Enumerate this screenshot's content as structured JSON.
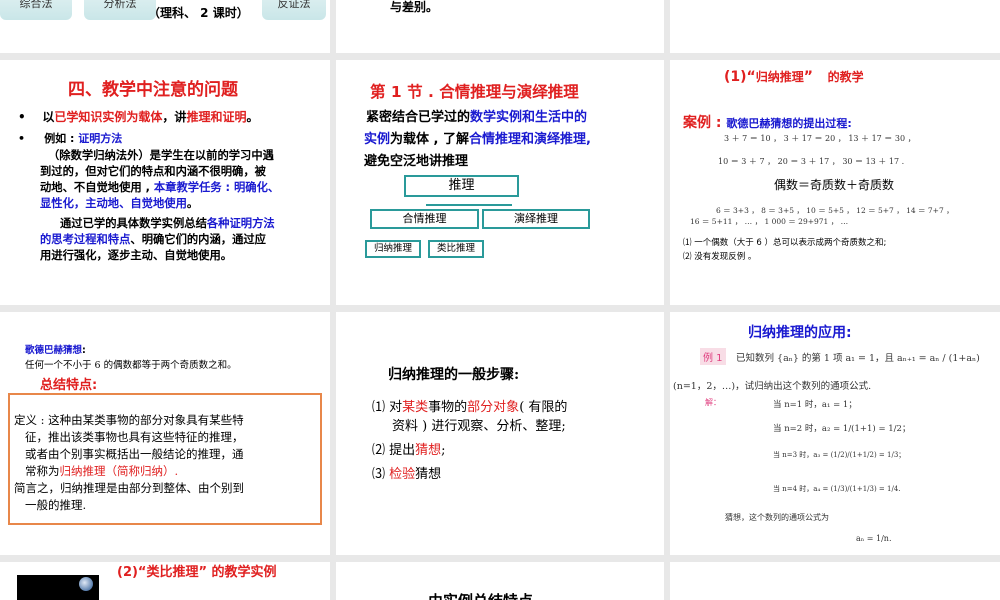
{
  "slide_top_left": {
    "buttons": [
      "综合法",
      "分析法",
      "反证法"
    ],
    "note": "（理科、 2 课时）"
  },
  "slide_top_mid": {
    "text": "与差别。"
  },
  "slide4": {
    "title": "四、教学中注意的问题",
    "b1": [
      "以",
      "已学知识实例为载体",
      "，讲",
      "推理和证明",
      "。"
    ],
    "b2": [
      "例如 : ",
      "证明方法"
    ],
    "p1": [
      "（除数学归纳法外）是学生在以前的学习中遇",
      "到过的，但对它们的特点和内涵不很明确，被",
      "动地、不自觉地使用 , ",
      "本章教学任务 : 明确化、",
      "显性化，主动地、自觉地使用",
      "。"
    ],
    "p2": [
      "通过已学的具体数学实例总结",
      "各种证明方法",
      "的思考过程和特点",
      "、明确它们的内涵，通过应",
      "用进行强化，逐步主动、自觉地使用。"
    ]
  },
  "slide5": {
    "title": "第 1 节 . 合情推理与演绎推理",
    "l1": [
      "紧密结合已学过的",
      "数学实例和生活中的"
    ],
    "l2": [
      "实例",
      "为载体 , 了解",
      "合情推理和演绎推理,"
    ],
    "l3": "避免空泛地讲推理",
    "diagram": {
      "root": "推理",
      "a": "合情推理",
      "b": "演绎推理",
      "a1": "归纳推理",
      "a2": "类比推理"
    }
  },
  "slide6": {
    "title_a": "(1)“",
    "title_b": "归纳推理",
    "title_c": "”",
    "title_d": "的教学",
    "case_label": "案例 : ",
    "case_text": "歌德巴赫猜想的提出过程:",
    "eq1": "3 ＋ 7 ＝ 10 ， 3 ＋ 17 ＝ 20 ， 13 ＋ 17 ＝ 30 ，",
    "eq2": "10 ＝ 3 ＋ 7 ， 20 ＝ 3 ＋ 17 ， 30 ＝ 13 ＋ 17 .",
    "rule": "偶数＝奇质数＋奇质数",
    "eq3": "6 ＝ 3+3 ， 8 ＝ 3+5 ， 10 ＝ 5+5 ， 12 ＝ 5+7 ， 14 ＝ 7+7 ，",
    "eq4": "16 ＝ 5+11 ，  … ，              1 000 ＝ 29+971 ，  …",
    "c1": "⑴  一个偶数（大于 6 ）总可以表示成两个奇质数之和;",
    "c2": "⑵  没有发现反例 。"
  },
  "slide7": {
    "conj_label": "歌德巴赫猜想",
    "conj_colon": ":",
    "conj": "任何一个不小于 6 的偶数都等于两个奇质数之和。",
    "summary": "总结特点:",
    "d1": "定义 : 这种由某类事物的部分对象具有某些特",
    "d2": "征，推出该类事物也具有这些特征的推理，",
    "d3": "或者由个别事实概括出一般结论的推理，通",
    "d4a": "常称为",
    "d4b": "归纳推理（简称归纳）.",
    "d5": "简言之，归纳推理是由部分到整体、由个别到",
    "d6": "一般的推理."
  },
  "slide8": {
    "title": "归纳推理的一般步骤:",
    "s1": [
      "⑴  对",
      "某类",
      "事物的",
      "部分对象",
      "( 有限的"
    ],
    "s1b": "资料 ) 进行观察、分析、整理;",
    "s2": [
      "⑵  提出",
      "猜想",
      ";"
    ],
    "s3": [
      "⑶  ",
      "检验",
      "猜想"
    ]
  },
  "slide9": {
    "title": "归纳推理的应用:",
    "ex": "例 1",
    "q1": "已知数列 {aₙ} 的第 1 项 a₁ = 1，且 aₙ₊₁ = aₙ / (1+aₙ)",
    "q2": "(n=1，2，…)，试归纳出这个数列的通项公式.",
    "sol": "解：",
    "r1": "当 n=1 时，a₁ = 1；",
    "r2": "当 n=2 时，a₂ = 1/(1+1) = 1/2；",
    "r3": "当 n=3 时，a₃ = (1/2)/(1+1/2) = 1/3；",
    "r4": "当 n=4 时，a₄ = (1/3)/(1+1/3) = 1/4.",
    "guess": "猜想，这个数列的通项公式为",
    "ans": "aₙ = 1/n."
  },
  "slide10": {
    "title": "(2)“类比推理” 的教学实例"
  },
  "slide11": {
    "title": "由实例总结特点"
  }
}
